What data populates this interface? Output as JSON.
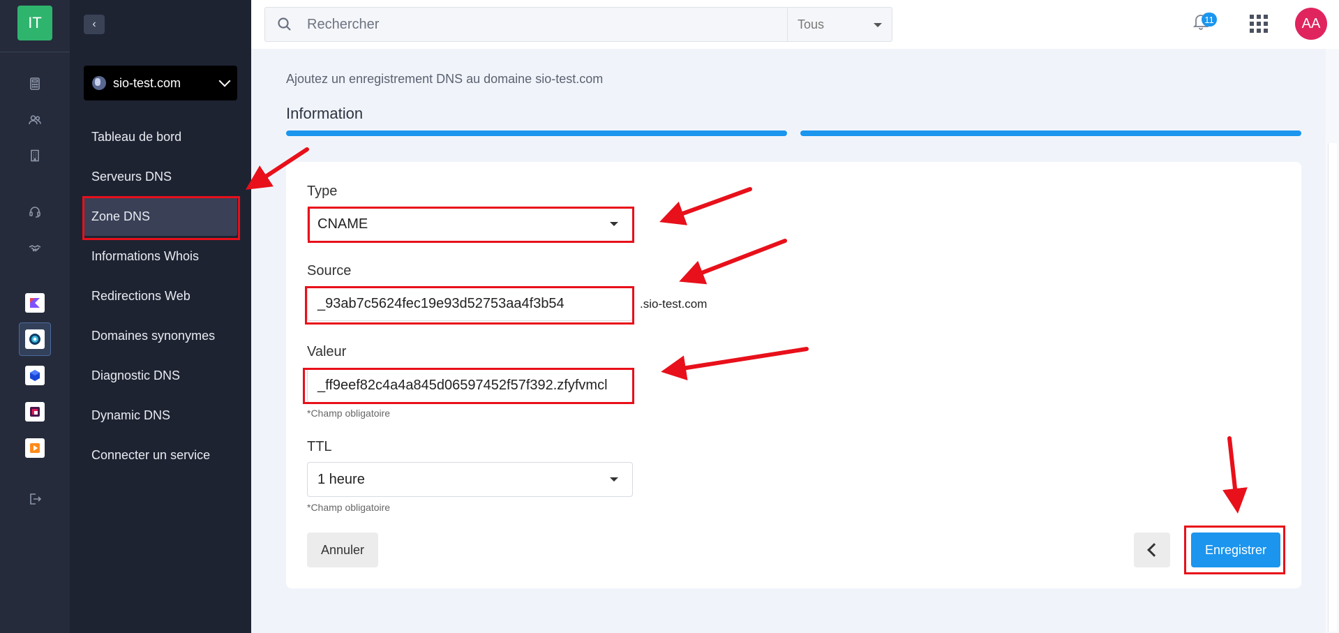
{
  "app": {
    "logo_text": "IT"
  },
  "rail": {
    "icons": [
      "calculator-icon",
      "users-icon",
      "building-icon",
      "headset-icon",
      "handshake-icon",
      "kotlin-app-icon",
      "dns-app-icon",
      "cube-app-icon",
      "slack-app-icon",
      "media-app-icon",
      "logout-icon"
    ],
    "active": "dns-app-icon"
  },
  "sidebar": {
    "domain": "sio-test.com",
    "items": [
      {
        "label": "Tableau de bord"
      },
      {
        "label": "Serveurs DNS"
      },
      {
        "label": "Zone DNS",
        "active": true
      },
      {
        "label": "Informations Whois"
      },
      {
        "label": "Redirections Web"
      },
      {
        "label": "Domaines synonymes"
      },
      {
        "label": "Diagnostic DNS"
      },
      {
        "label": "Dynamic DNS"
      },
      {
        "label": "Connecter un service"
      }
    ]
  },
  "topbar": {
    "search_placeholder": "Rechercher",
    "scope": "Tous",
    "notifications_count": "11",
    "avatar_initials": "AA"
  },
  "main": {
    "subtitle": "Ajoutez un enregistrement DNS au domaine sio-test.com",
    "step_title": "Information",
    "progress_steps_completed": 2,
    "progress_steps_total": 2,
    "form": {
      "type_label": "Type",
      "type_value": "CNAME",
      "source_label": "Source",
      "source_value": "_93ab7c5624fec19e93d52753aa4f3b54",
      "source_suffix": ".sio-test.com",
      "value_label": "Valeur",
      "value_value": "_ff9eef82c4a4a845d06597452f57f392.zfyfvmcl",
      "required_hint": "*Champ obligatoire",
      "ttl_label": "TTL",
      "ttl_value": "1 heure"
    },
    "cancel_label": "Annuler",
    "save_label": "Enregistrer"
  },
  "colors": {
    "accent": "#1b95ee",
    "annotation": "#e8101a",
    "sidebar": "#1e2332",
    "rail": "#252b3b"
  }
}
